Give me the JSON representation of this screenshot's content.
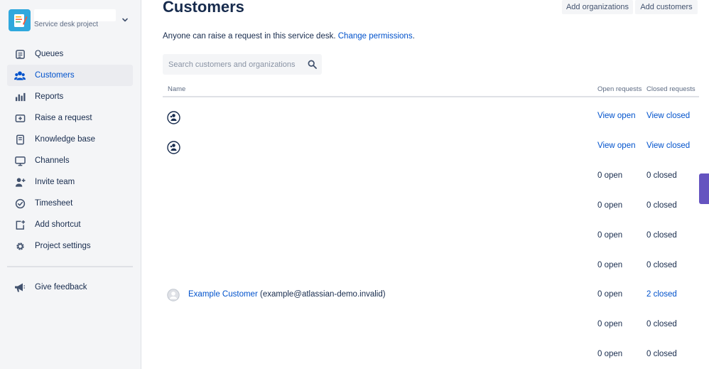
{
  "sidebar": {
    "project_type": "Service desk project",
    "items": [
      {
        "label": "Queues",
        "icon": "queues-icon",
        "active": false
      },
      {
        "label": "Customers",
        "icon": "customers-icon",
        "active": true
      },
      {
        "label": "Reports",
        "icon": "reports-icon",
        "active": false
      },
      {
        "label": "Raise a request",
        "icon": "raise-request-icon",
        "active": false
      },
      {
        "label": "Knowledge base",
        "icon": "knowledge-base-icon",
        "active": false
      },
      {
        "label": "Channels",
        "icon": "monitor-icon",
        "active": false
      },
      {
        "label": "Invite team",
        "icon": "invite-team-icon",
        "active": false
      },
      {
        "label": "Timesheet",
        "icon": "check-circle-icon",
        "active": false
      },
      {
        "label": "Add shortcut",
        "icon": "add-shortcut-icon",
        "active": false
      },
      {
        "label": "Project settings",
        "icon": "gear-icon",
        "active": false
      }
    ],
    "feedback": {
      "label": "Give feedback",
      "icon": "megaphone-icon"
    }
  },
  "main": {
    "title": "Customers",
    "buttons": {
      "add_organizations": "Add organizations",
      "add_customers": "Add customers"
    },
    "info": {
      "text": "Anyone can raise a request in this service desk.",
      "link": "Change permissions",
      "suffix": "."
    },
    "search": {
      "placeholder": "Search customers and organizations"
    },
    "table": {
      "headers": {
        "name": "Name",
        "open": "Open requests",
        "closed": "Closed requests"
      },
      "rows": [
        {
          "type": "organization",
          "name": "",
          "email": "",
          "open": "View open",
          "closed": "View closed",
          "open_link": true,
          "closed_link": true
        },
        {
          "type": "organization",
          "name": "",
          "email": "",
          "open": "View open",
          "closed": "View closed",
          "open_link": true,
          "closed_link": true
        },
        {
          "type": "blank",
          "name": "",
          "email": "",
          "open": "0 open",
          "closed": "0 closed",
          "open_link": false,
          "closed_link": false
        },
        {
          "type": "blank",
          "name": "",
          "email": "",
          "open": "0 open",
          "closed": "0 closed",
          "open_link": false,
          "closed_link": false
        },
        {
          "type": "blank",
          "name": "",
          "email": "",
          "open": "0 open",
          "closed": "0 closed",
          "open_link": false,
          "closed_link": false
        },
        {
          "type": "blank",
          "name": "",
          "email": "",
          "open": "0 open",
          "closed": "0 closed",
          "open_link": false,
          "closed_link": false
        },
        {
          "type": "customer",
          "name": "Example Customer",
          "email": "(example@atlassian-demo.invalid)",
          "open": "0 open",
          "closed": "2 closed",
          "open_link": false,
          "closed_link": true
        },
        {
          "type": "blank",
          "name": "",
          "email": "",
          "open": "0 open",
          "closed": "0 closed",
          "open_link": false,
          "closed_link": false
        },
        {
          "type": "blank",
          "name": "",
          "email": "",
          "open": "0 open",
          "closed": "0 closed",
          "open_link": false,
          "closed_link": false
        }
      ]
    }
  },
  "colors": {
    "link": "#0052cc",
    "text": "#172b4d",
    "sidebar_bg": "#f4f5f7",
    "active_bg": "#ebecf0",
    "side_tab": "#6554c0"
  }
}
